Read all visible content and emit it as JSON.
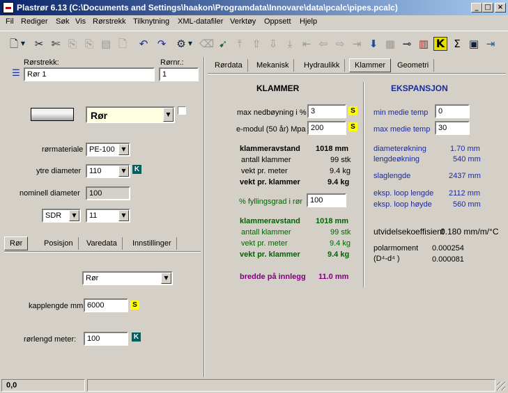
{
  "window": {
    "title": "Plastrør 6.13  (C:\\Documents and Settings\\haakon\\Programdata\\Innovare\\data\\pcalc\\pipes.pcalc)"
  },
  "menu": [
    "Fil",
    "Rediger",
    "Søk",
    "Vis",
    "Rørstrekk",
    "Tilknytning",
    "XML-datafiler",
    "Verktøy",
    "Oppsett",
    "Hjelp"
  ],
  "left": {
    "rorstrekk_label": "Rørstrekk:",
    "rorstrekk_value": "Rør 1",
    "rornr_label": "Rørnr.:",
    "rornr_value": "1",
    "type_select": "Rør",
    "rormateriale_label": "rørmateriale",
    "rormateriale_value": "PE-100",
    "ytre_label": "ytre diameter",
    "ytre_value": "110",
    "nominell_label": "nominell diameter",
    "nominell_value": "100",
    "sdr_label": "SDR",
    "sdr_value": "11",
    "tabs": [
      "Rør",
      "Posisjon",
      "Varedata",
      "Innstillinger"
    ],
    "sub_select": "Rør",
    "kapplengde_label": "kapplengde mm:",
    "kapplengde_value": "6000",
    "rorlengde_label": "rørlengd meter:",
    "rorlengde_value": "100"
  },
  "right_tabs": [
    "Rørdata",
    "Mekanisk",
    "Hydraulikk",
    "Klammer",
    "Geometri"
  ],
  "klammer": {
    "heading": "KLAMMER",
    "max_nedboyning_label": "max nedbøyning i %",
    "max_nedboyning_value": "3",
    "emodul_label": "e-modul (50 år) Mpa",
    "emodul_value": "200",
    "r1": {
      "klammeravstand_label": "klammeravstand",
      "klammeravstand_value": "1018 mm",
      "antall_label": "antall klammer",
      "antall_value": "99 stk",
      "vekt_meter_label": "vekt pr. meter",
      "vekt_meter_value": "9.4 kg",
      "vekt_klammer_label": "vekt pr. klammer",
      "vekt_klammer_value": "9.4 kg"
    },
    "fylling_label": "% fyllingsgrad i rør",
    "fylling_value": "100",
    "r2": {
      "klammeravstand_label": "klammeravstand",
      "klammeravstand_value": "1018 mm",
      "antall_label": "antall klammer",
      "antall_value": "99 stk",
      "vekt_meter_label": "vekt pr. meter",
      "vekt_meter_value": "9.4 kg",
      "vekt_klammer_label": "vekt pr. klammer",
      "vekt_klammer_value": "9.4 kg"
    },
    "bredde_label": "bredde på innlegg",
    "bredde_value": "11.0 mm"
  },
  "ekspansjon": {
    "heading": "EKSPANSJON",
    "min_temp_label": "min medie temp",
    "min_temp_value": "0",
    "max_temp_label": "max medie temp",
    "max_temp_value": "30",
    "diameter_label": "diameterøkning",
    "diameter_value": "1.70 mm",
    "lengde_label": "lengdeøkning",
    "lengde_value": "540 mm",
    "slag_label": "slaglengde",
    "slag_value": "2437 mm",
    "loop_lengde_label": "eksp. loop lengde",
    "loop_lengde_value": "2112 mm",
    "loop_hoyde_label": "eksp. loop høyde",
    "loop_hoyde_value": "560 mm",
    "utvidelse_label": "utvidelsekoeffisient",
    "utvidelse_value": "0.180 mm/m/°C",
    "polar_label": "polarmoment",
    "polar_value": "0.000254",
    "d4_label": "(D⁴-d⁴ )",
    "d4_value": "0.000081"
  },
  "status": {
    "coords": "0,0"
  },
  "badges": {
    "s": "S",
    "k": "K"
  }
}
